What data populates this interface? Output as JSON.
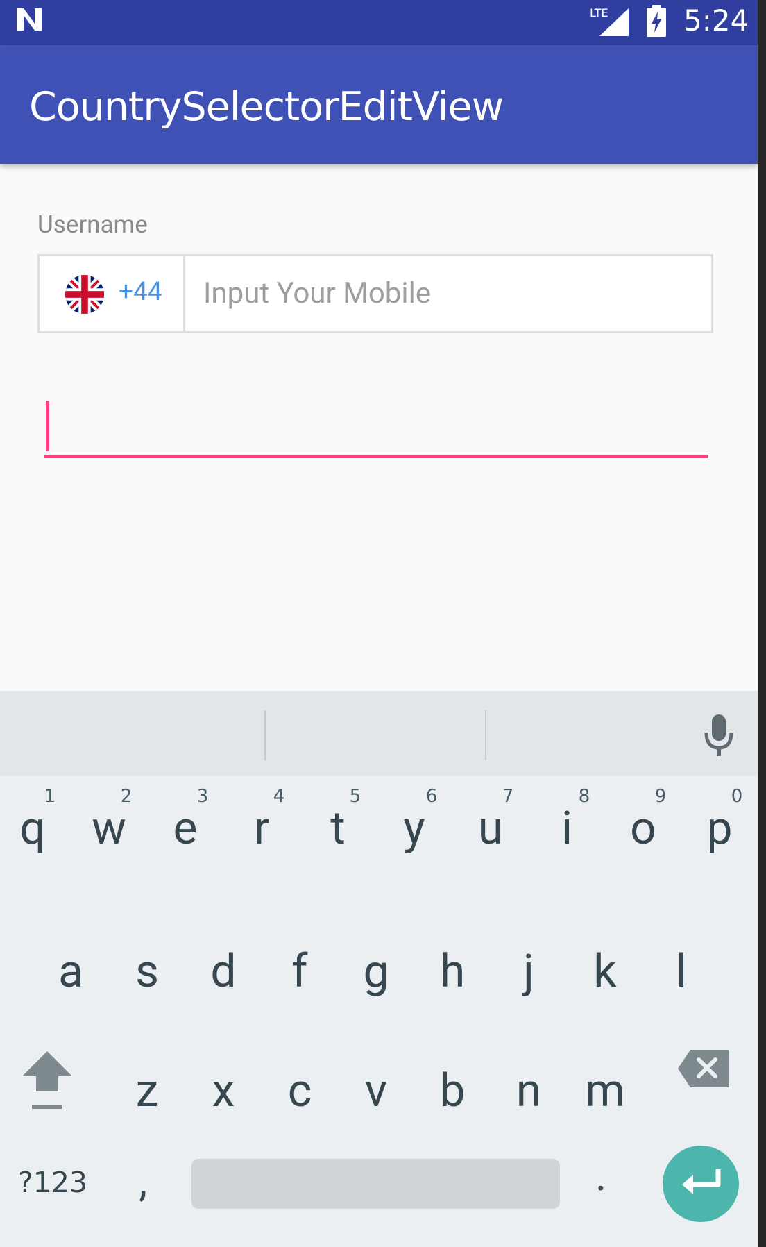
{
  "status_bar": {
    "time": "5:24",
    "network": "LTE",
    "icons": [
      "notification-n-icon",
      "lte-signal-icon",
      "battery-charging-icon"
    ]
  },
  "app_bar": {
    "title": "CountrySelectorEditView",
    "background": "#3f51b5"
  },
  "form": {
    "label": "Username",
    "country": {
      "flag_icon": "uk-flag-icon",
      "dial_code": "+44"
    },
    "mobile_placeholder": "Input Your Mobile",
    "mobile_value": "",
    "focused_field_value": "",
    "accent": "#ff4081",
    "dial_code_color": "#4a90e2"
  },
  "keyboard": {
    "suggestions": [
      "",
      "",
      ""
    ],
    "row1": [
      {
        "key": "q",
        "hint": "1"
      },
      {
        "key": "w",
        "hint": "2"
      },
      {
        "key": "e",
        "hint": "3"
      },
      {
        "key": "r",
        "hint": "4"
      },
      {
        "key": "t",
        "hint": "5"
      },
      {
        "key": "y",
        "hint": "6"
      },
      {
        "key": "u",
        "hint": "7"
      },
      {
        "key": "i",
        "hint": "8"
      },
      {
        "key": "o",
        "hint": "9"
      },
      {
        "key": "p",
        "hint": "0"
      }
    ],
    "row2": [
      "a",
      "s",
      "d",
      "f",
      "g",
      "h",
      "j",
      "k",
      "l"
    ],
    "row3": [
      "z",
      "x",
      "c",
      "v",
      "b",
      "n",
      "m"
    ],
    "symbols_label": "?123",
    "comma": ",",
    "period": ".",
    "enter_color": "#4db6ac",
    "icons": [
      "microphone-icon",
      "shift-icon",
      "backspace-icon",
      "enter-icon"
    ]
  }
}
